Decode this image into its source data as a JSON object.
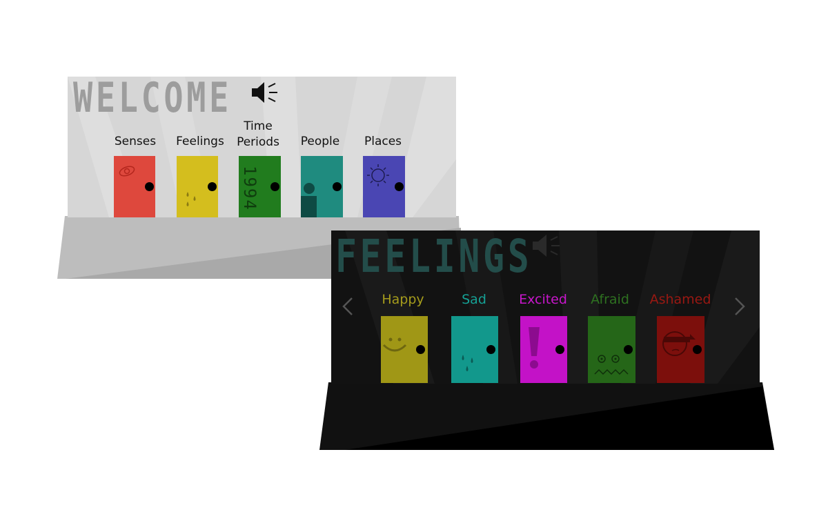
{
  "welcome": {
    "title": "WELCOME",
    "speaker_icon": "speaker-icon",
    "doors": [
      {
        "label": "Senses",
        "color": "#de483d",
        "icon": "eye-icon"
      },
      {
        "label": "Feelings",
        "color": "#d4be1e",
        "icon": "drops-icon"
      },
      {
        "label_line1": "Time",
        "label_line2": "Periods",
        "color": "#217c1e",
        "icon": "year-text",
        "year": "1994"
      },
      {
        "label": "People",
        "color": "#1f8b7f",
        "icon": "person-icon"
      },
      {
        "label": "Places",
        "color": "#4a46b3",
        "icon": "sun-icon"
      }
    ]
  },
  "feelings": {
    "title": "FEELINGS",
    "speaker_icon": "speaker-icon",
    "prev_icon": "chevron-left-icon",
    "next_icon": "chevron-right-icon",
    "doors": [
      {
        "label": "Happy",
        "color": "#a09716",
        "label_color": "#a59c1c",
        "icon": "smile-icon"
      },
      {
        "label": "Sad",
        "color": "#12988c",
        "label_color": "#15a195",
        "icon": "tears-icon"
      },
      {
        "label": "Excited",
        "color": "#c312c7",
        "label_color": "#c916cc",
        "icon": "exclamation-icon"
      },
      {
        "label": "Afraid",
        "color": "#256618",
        "label_color": "#2e7120",
        "icon": "scared-face-icon"
      },
      {
        "label": "Ashamed",
        "color": "#7c0f0c",
        "label_color": "#9a1812",
        "icon": "ashamed-face-icon"
      }
    ]
  }
}
